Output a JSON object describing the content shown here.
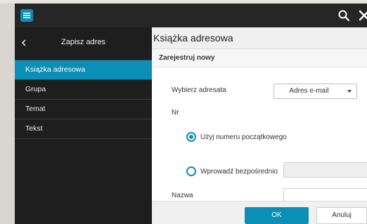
{
  "colors": {
    "accent": "#0b8fb6",
    "topbar": "#262626",
    "sidebar": "#1e1e1e"
  },
  "topbar": {
    "menu_icon": "hamburger-menu-icon",
    "search_icon": "search-icon",
    "close_icon": "close-icon"
  },
  "sidebar": {
    "back_icon": "chevron-left-icon",
    "title": "Zapisz adres",
    "items": [
      {
        "label": "Książka adresowa",
        "active": true
      },
      {
        "label": "Grupa",
        "active": false
      },
      {
        "label": "Temat",
        "active": false
      },
      {
        "label": "Tekst",
        "active": false
      }
    ]
  },
  "main": {
    "title": "Książka adresowa",
    "section": "Zarejestruj nowy",
    "select_recipient_label": "Wybierz adresata",
    "recipient_select": {
      "value": "Adres e-mail"
    },
    "nr_label": "Nr",
    "radio_start_number": {
      "label": "Użyj numeru początkowego",
      "checked": true
    },
    "radio_direct": {
      "label": "Wprowadź bezpośrednio",
      "checked": false
    },
    "name_label": "Nazwa"
  },
  "footer": {
    "ok_label": "OK",
    "cancel_label": "Anuluj"
  }
}
